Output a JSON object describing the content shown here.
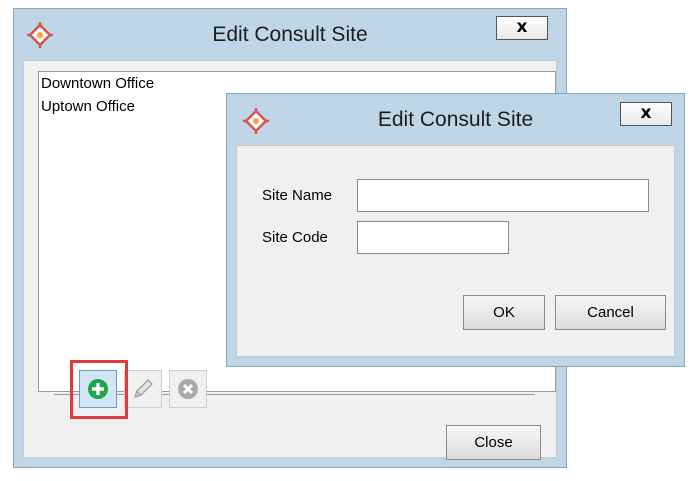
{
  "outer_dialog": {
    "title": "Edit Consult Site",
    "close_label": "x",
    "list_items": [
      "Downtown Office",
      "Uptown Office"
    ],
    "toolbar": {
      "add_icon": "add-circle-icon",
      "edit_icon": "pencil-icon",
      "remove_icon": "remove-circle-icon"
    },
    "close_button_label": "Close"
  },
  "inner_dialog": {
    "title": "Edit Consult Site",
    "close_label": "x",
    "site_name_label": "Site Name",
    "site_name_value": "",
    "site_code_label": "Site Code",
    "site_code_value": "",
    "ok_label": "OK",
    "cancel_label": "Cancel"
  },
  "colors": {
    "dialog_frame": "#bfd6e6",
    "client_bg": "#f0f0f0",
    "highlight": "#e23b3b",
    "add_green": "#1fa64a",
    "app_icon_red": "#d9534f"
  }
}
